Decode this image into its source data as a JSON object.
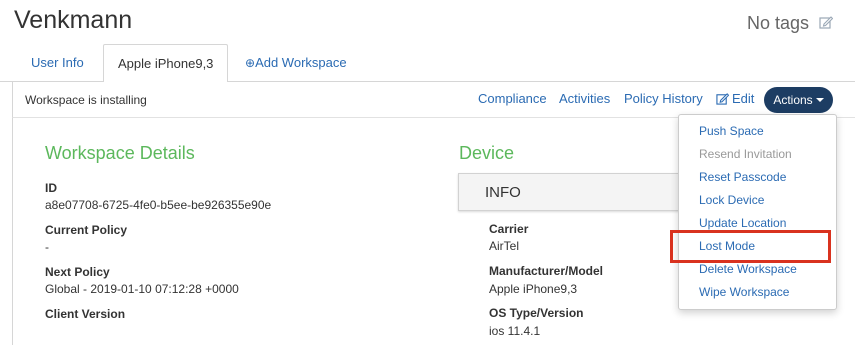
{
  "header": {
    "title": "Venkmann",
    "tags_label": "No tags"
  },
  "tabs": [
    {
      "label": "User Info"
    },
    {
      "label": "Apple iPhone9,3"
    },
    {
      "label": "Add Workspace",
      "prefix": "⊕"
    }
  ],
  "status": {
    "text": "Workspace is installing",
    "links": [
      "Compliance",
      "Activities",
      "Policy History"
    ],
    "edit_label": "Edit",
    "actions_label": "Actions"
  },
  "workspace_details": {
    "title": "Workspace Details",
    "fields": [
      {
        "label": "ID",
        "value": "a8e07708-6725-4fe0-b5ee-be926355e90e"
      },
      {
        "label": "Current Policy",
        "value": "-"
      },
      {
        "label": "Next Policy",
        "value": "Global - 2019-01-10 07:12:28 +0000"
      },
      {
        "label": "Client Version",
        "value": ""
      }
    ]
  },
  "device": {
    "title": "Device",
    "info_label": "INFO",
    "fields": [
      {
        "label": "Carrier",
        "value": "AirTel"
      },
      {
        "label": "Manufacturer/Model",
        "value": "Apple iPhone9,3"
      },
      {
        "label": "OS Type/Version",
        "value": "ios 11.4.1"
      }
    ]
  },
  "actions_menu": {
    "items": [
      {
        "label": "Push Space",
        "enabled": true
      },
      {
        "label": "Resend Invitation",
        "enabled": false
      },
      {
        "label": "Reset Passcode",
        "enabled": true
      },
      {
        "label": "Lock Device",
        "enabled": true
      },
      {
        "label": "Update Location",
        "enabled": true
      },
      {
        "label": "Lost Mode",
        "enabled": true,
        "highlighted": true
      },
      {
        "label": "Delete Workspace",
        "enabled": true
      },
      {
        "label": "Wipe Workspace",
        "enabled": true
      }
    ]
  },
  "colors": {
    "link": "#2b6bb3",
    "section_title": "#5cb85c",
    "actions_button": "#1d3d63",
    "highlight_box": "#d9321f"
  }
}
